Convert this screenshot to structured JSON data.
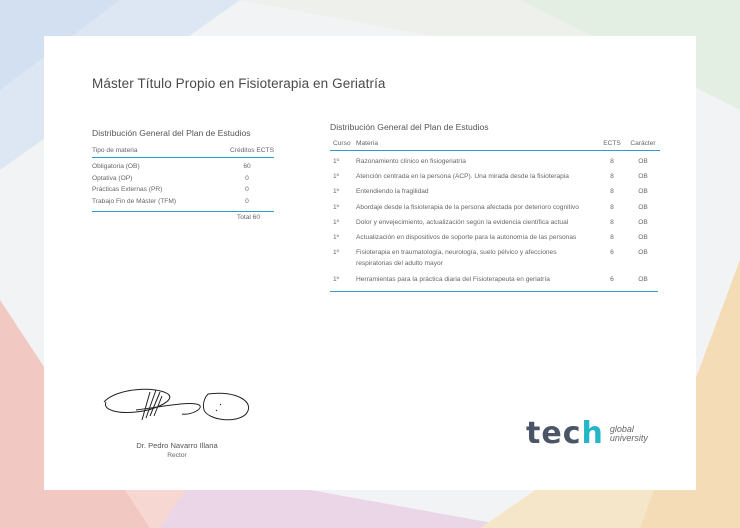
{
  "page": {
    "title": "Máster Título Propio en Fisioterapia en Geriatría"
  },
  "summary": {
    "heading": "Distribución General del Plan de Estudios",
    "col_type": "Tipo de materia",
    "col_credits": "Créditos ECTS",
    "rows": [
      {
        "name": "Obligatoria (OB)",
        "value": "60"
      },
      {
        "name": "Optativa (OP)",
        "value": "0"
      },
      {
        "name": "Prácticas Externas (PR)",
        "value": "0"
      },
      {
        "name": "Trabajo Fin de Máster (TFM)",
        "value": "0"
      }
    ],
    "total": "Total 60"
  },
  "subjects": {
    "heading": "Distribución General del Plan de Estudios",
    "col_course": "Curso",
    "col_subject": "Materia",
    "col_ects": "ECTS",
    "col_type": "Carácter",
    "rows": [
      {
        "course": "1º",
        "subject": "Razonamiento clínico en fisiogeriatría",
        "ects": "8",
        "type": "OB"
      },
      {
        "course": "1º",
        "subject": "Atención centrada en la persona (ACP). Una mirada desde la fisioterapia",
        "ects": "8",
        "type": "OB"
      },
      {
        "course": "1º",
        "subject": "Entendiendo la fragilidad",
        "ects": "8",
        "type": "OB"
      },
      {
        "course": "1º",
        "subject": "Abordaje desde la fisioterapia de la persona afectada por deterioro cognitivo",
        "ects": "8",
        "type": "OB"
      },
      {
        "course": "1º",
        "subject": "Dolor y envejecimiento, actualización según la evidencia científica actual",
        "ects": "8",
        "type": "OB"
      },
      {
        "course": "1º",
        "subject": "Actualización en dispositivos de soporte para la autonomía de las personas",
        "ects": "8",
        "type": "OB"
      },
      {
        "course": "1º",
        "subject": "Fisioterapia en traumatología, neurología, suelo pélvico y afecciones respiratorias del adulto mayor",
        "ects": "6",
        "type": "OB"
      },
      {
        "course": "1º",
        "subject": "Herramientas para la práctica diaria del Fisioterapeuta en geriatría",
        "ects": "6",
        "type": "OB"
      }
    ]
  },
  "signature": {
    "name": "Dr. Pedro Navarro Illana",
    "role": "Rector"
  },
  "logo": {
    "word_a": "tec",
    "word_b": "h",
    "line1": "global",
    "line2": "university"
  },
  "colors": {
    "accent": "#2b9bd1",
    "brand_teal": "#25b7c9",
    "brand_gray": "#4a5568"
  }
}
